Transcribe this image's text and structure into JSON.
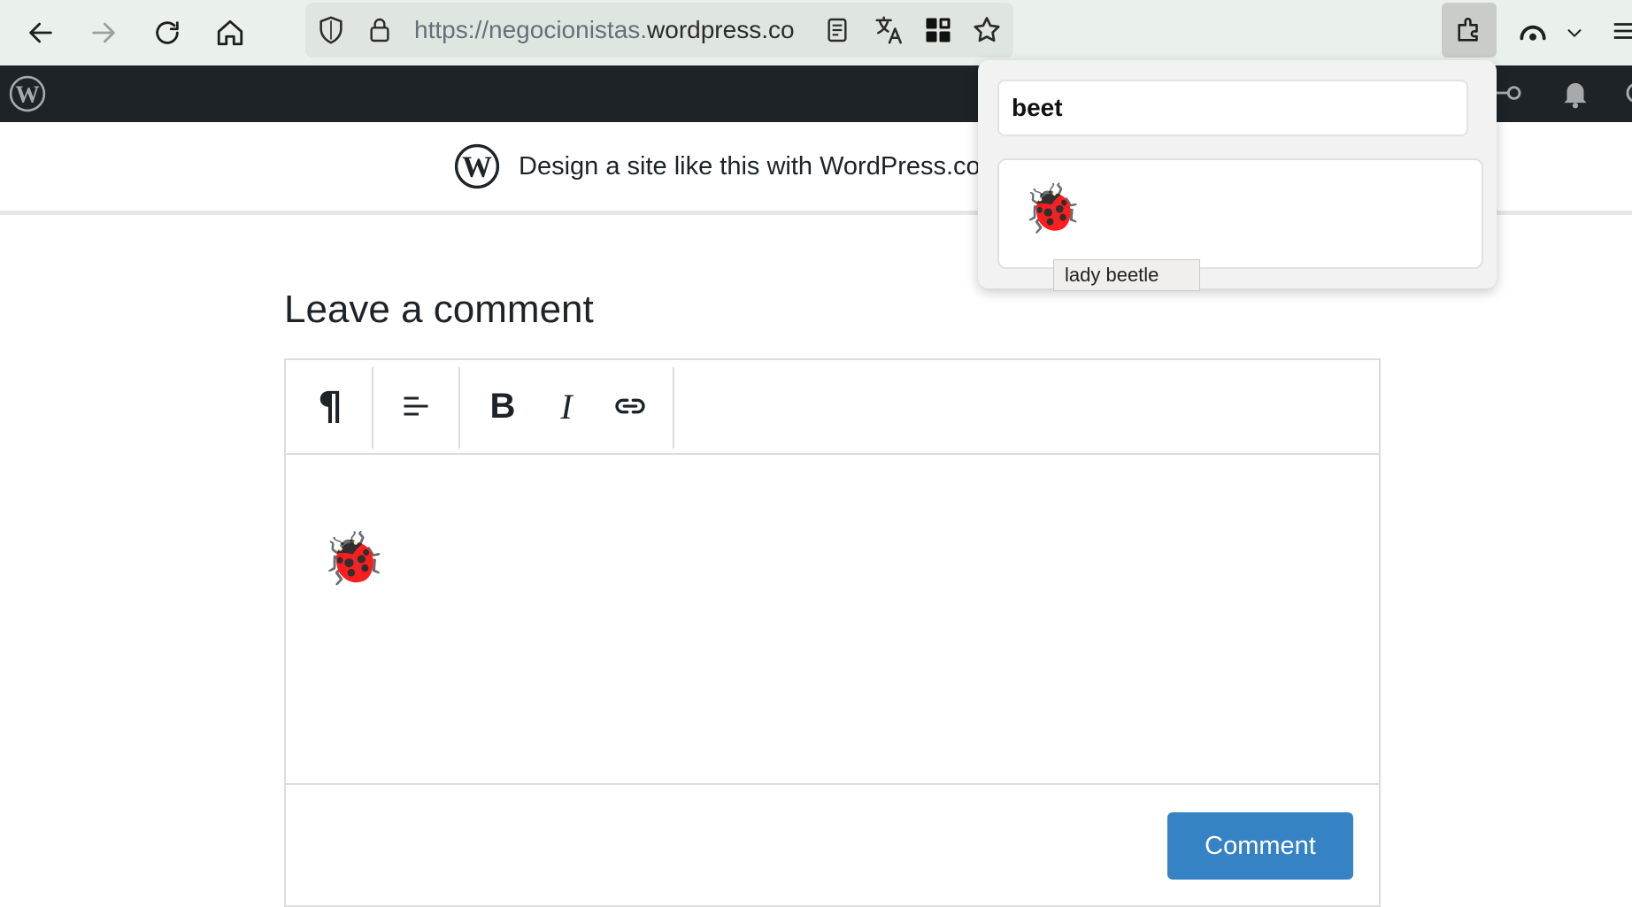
{
  "browser": {
    "url_prefix": "https://negocionistas.",
    "url_host": "wordpress.co",
    "icons": [
      "back-arrow-icon",
      "forward-arrow-icon",
      "reload-icon",
      "home-icon",
      "shield-icon",
      "lock-icon",
      "reader-view-icon",
      "translate-icon",
      "qr-code-icon",
      "bookmark-star-icon",
      "extensions-icon",
      "profile-icon",
      "chevron-down-icon",
      "menu-icon"
    ]
  },
  "banner": {
    "text": "Design a site like this with WordPress.co"
  },
  "comment": {
    "title": "Leave a comment",
    "toolbar": {
      "paragraph": "¶",
      "bold": "B",
      "italic": "I"
    },
    "content_emoji": "🐞",
    "submit_label": "Comment"
  },
  "emoji_popup": {
    "search_value": "beet",
    "result_emoji": "🐞",
    "tooltip": "lady beetle"
  },
  "colors": {
    "toolbar_bg": "#eaf1ec",
    "adminbar_bg": "#1d2327",
    "accent": "#3582c4"
  }
}
